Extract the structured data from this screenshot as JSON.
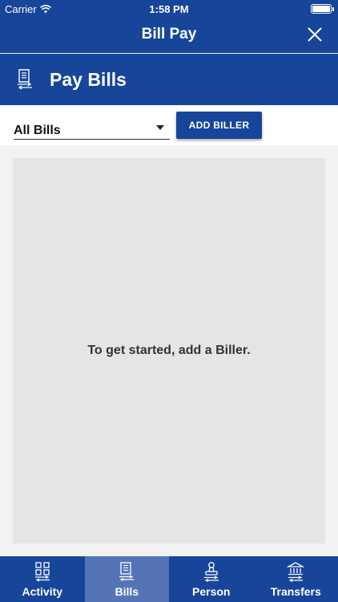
{
  "status_bar": {
    "carrier": "Carrier",
    "time": "1:58 PM",
    "battery_level": 1.0
  },
  "nav": {
    "title": "Bill Pay",
    "close_icon": "close-icon"
  },
  "section": {
    "icon": "bill-icon",
    "title": "Pay Bills"
  },
  "filter": {
    "selected": "All Bills",
    "add_button": "ADD BILLER"
  },
  "empty_state": {
    "message": "To get started, add a Biller."
  },
  "tabs": [
    {
      "label": "Activity",
      "icon": "activity-grid-icon",
      "active": false
    },
    {
      "label": "Bills",
      "icon": "bill-icon",
      "active": true
    },
    {
      "label": "Person",
      "icon": "person-stamp-icon",
      "active": false
    },
    {
      "label": "Transfers",
      "icon": "bank-icon",
      "active": false
    }
  ],
  "colors": {
    "primary": "#17459a",
    "tab_active": "#5474b7",
    "panel": "#e5e5e5",
    "background": "#f2f2f2"
  }
}
